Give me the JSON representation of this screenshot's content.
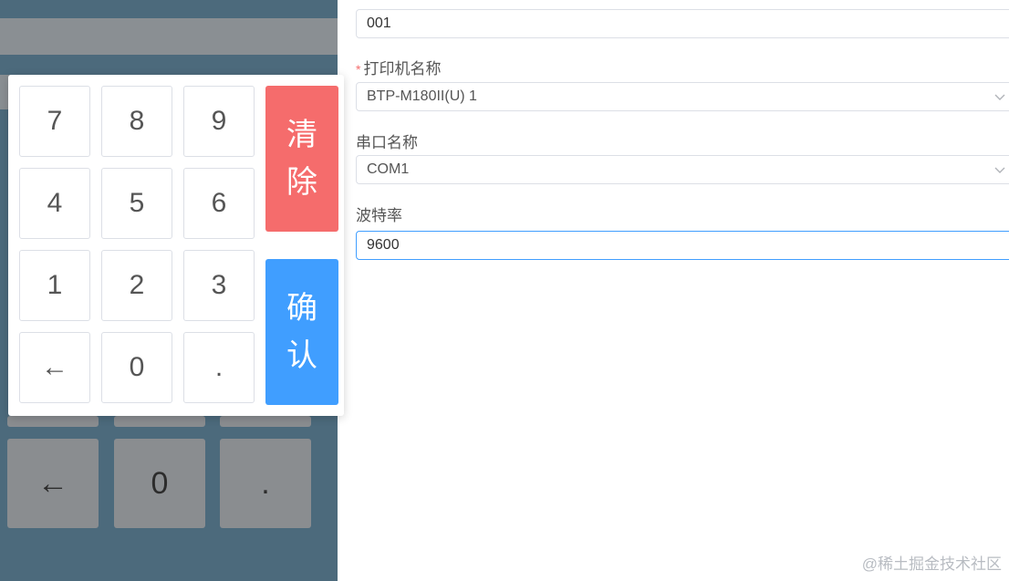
{
  "keypad": {
    "keys": [
      "7",
      "8",
      "9",
      "4",
      "5",
      "6",
      "1",
      "2",
      "3",
      "←",
      "0",
      "."
    ],
    "clear_label": "清除",
    "confirm_label": "确认"
  },
  "background_keys": [
    "←",
    "0",
    "."
  ],
  "form": {
    "code_value": "001",
    "printer_label": "打印机名称",
    "printer_required_mark": "*",
    "printer_value": "BTP-M180II(U) 1",
    "port_label": "串口名称",
    "port_value": "COM1",
    "baud_label": "波特率",
    "baud_value": "9600"
  },
  "watermark": "@稀土掘金技术社区",
  "colors": {
    "clear": "#f56c6c",
    "confirm": "#409eff",
    "overlay": "#4c6a7c"
  }
}
